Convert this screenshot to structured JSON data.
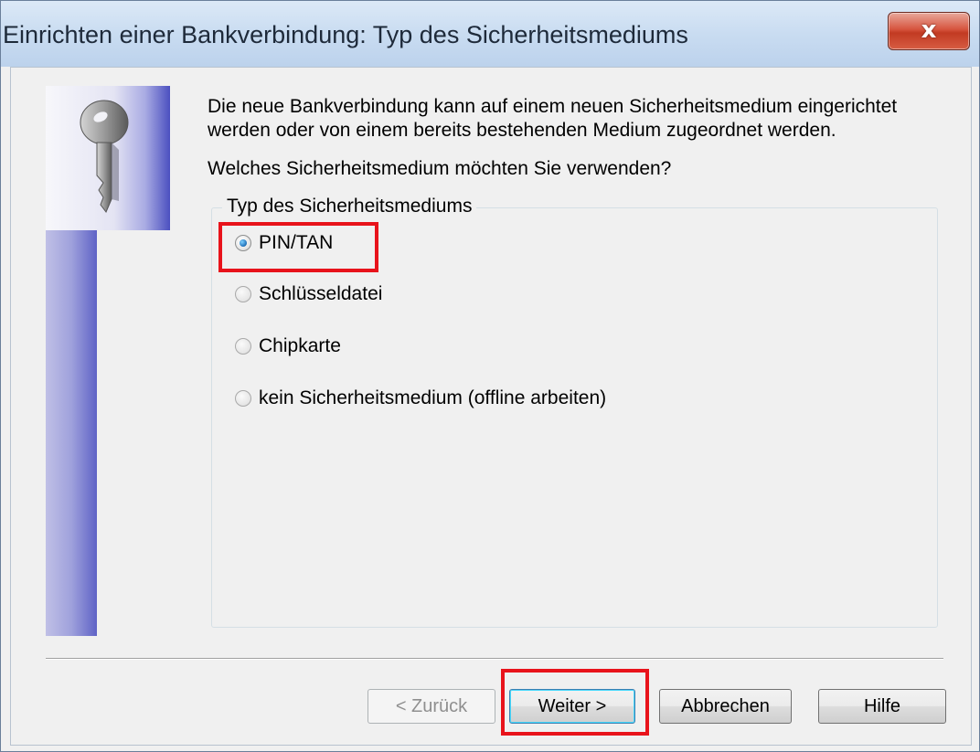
{
  "window": {
    "title": "Einrichten einer Bankverbindung: Typ des Sicherheitsmediums",
    "close_label": "x"
  },
  "content": {
    "intro": "Die neue Bankverbindung kann  auf einem neuen Sicherheitsmedium eingerichtet werden oder von einem bereits bestehenden Medium zugeordnet werden.",
    "question": "Welches Sicherheitsmedium möchten Sie verwenden?",
    "group_label": "Typ des Sicherheitsmediums",
    "options": [
      {
        "label": "PIN/TAN",
        "selected": true
      },
      {
        "label": "Schlüsseldatei",
        "selected": false
      },
      {
        "label": "Chipkarte",
        "selected": false
      },
      {
        "label": "kein Sicherheitsmedium (offline arbeiten)",
        "selected": false
      }
    ]
  },
  "buttons": {
    "back": "< Zurück",
    "next": "Weiter >",
    "cancel": "Abbrechen",
    "help": "Hilfe"
  },
  "colors": {
    "highlight": "#e8131b",
    "accent": "#5f63c6"
  },
  "icons": {
    "wizard_image": "key-icon",
    "close": "close-icon"
  }
}
